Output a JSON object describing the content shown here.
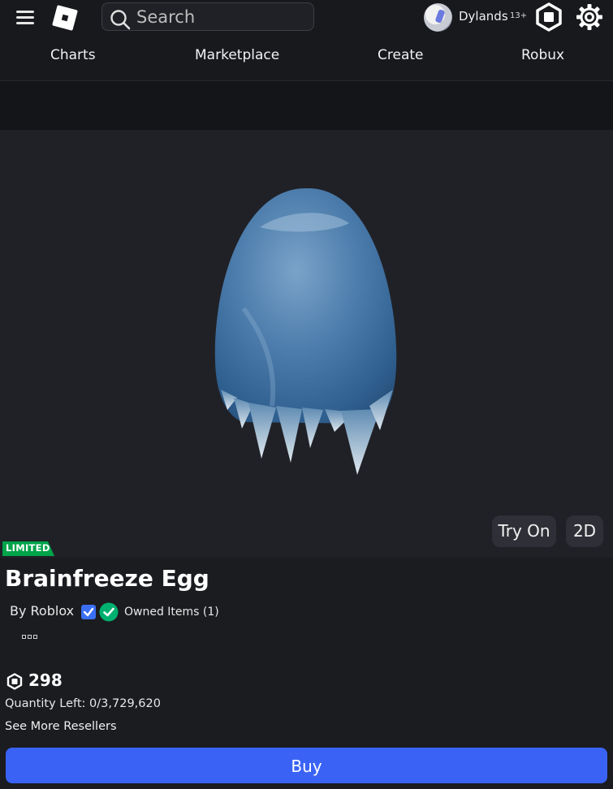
{
  "header": {
    "menu_icon": "hamburger-icon",
    "logo_icon": "roblox-logo-icon",
    "search": {
      "placeholder": "Search",
      "value": ""
    },
    "user": {
      "name": "Dylands",
      "age_badge": "13+"
    },
    "robux_icon": "robux-icon",
    "settings_icon": "gear-icon"
  },
  "nav": {
    "items": [
      {
        "label": "Charts"
      },
      {
        "label": "Marketplace"
      },
      {
        "label": "Create"
      },
      {
        "label": "Robux"
      }
    ]
  },
  "viewer": {
    "try_on_label": "Try On",
    "mode_label": "2D"
  },
  "item": {
    "badge": "LIMITED",
    "name": "Brainfreeze Egg",
    "creator_label": "By Roblox",
    "owned_label": "Owned Items (1)",
    "price": "298",
    "quantity_left": "Quantity Left: 0/3,729,620",
    "see_more_resellers": "See More Resellers",
    "buy_label": "Buy"
  },
  "colors": {
    "background": "#1b1c20",
    "viewer_bg": "#202127",
    "limited_badge": "#00a449",
    "buy_button": "#3a63f5",
    "verified": "#3b6ff3",
    "owned_check": "#00b06f"
  }
}
